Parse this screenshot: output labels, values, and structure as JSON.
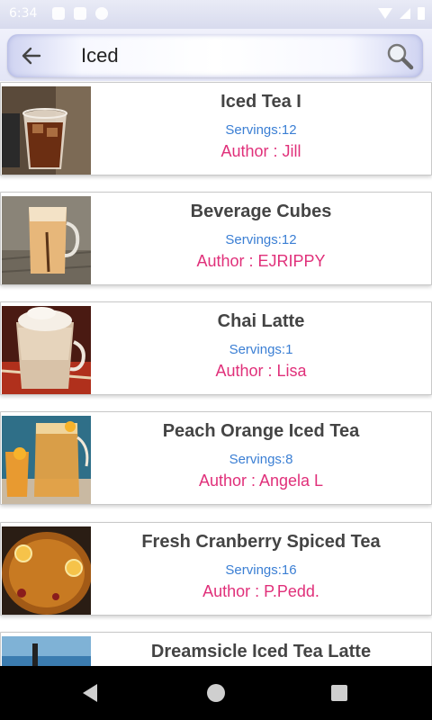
{
  "status_bar": {
    "time": "6:34"
  },
  "search": {
    "query": "Iced",
    "back_icon": "arrow-left-icon",
    "search_icon": "magnifier-icon"
  },
  "recipes": [
    {
      "title": "Iced Tea I",
      "servings": "Servings:12",
      "author": "Author : Jill"
    },
    {
      "title": "Beverage Cubes",
      "servings": "Servings:12",
      "author": "Author : EJRIPPY"
    },
    {
      "title": "Chai Latte",
      "servings": "Servings:1",
      "author": "Author : Lisa"
    },
    {
      "title": "Peach Orange Iced Tea",
      "servings": "Servings:8",
      "author": "Author : Angela L"
    },
    {
      "title": "Fresh Cranberry Spiced Tea",
      "servings": "Servings:16",
      "author": "Author : P.Pedd."
    },
    {
      "title": "Dreamsicle Iced Tea Latte",
      "servings": "",
      "author": ""
    }
  ],
  "colors": {
    "title": "#444444",
    "servings": "#3b7fd4",
    "author": "#e0307a"
  }
}
